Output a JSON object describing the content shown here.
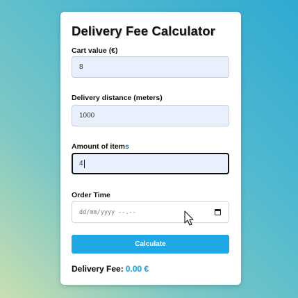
{
  "form": {
    "title": "Delivery Fee Calculator",
    "cart_value_label": "Cart value (€)",
    "cart_value": "8",
    "distance_label": "Delivery distance (meters)",
    "distance_value": "1000",
    "items_label_main": "Amount of item",
    "items_label_accent": "s",
    "items_value": "4",
    "order_time_label": "Order Time",
    "order_time_placeholder": "dd/mm/yyyy --.--",
    "calculate_label": "Calculate",
    "fee_label": "Delivery Fee:",
    "fee_value": "0.00 €"
  },
  "icons": {
    "calendar": "calendar-icon",
    "cursor": "mouse-pointer-icon"
  },
  "colors": {
    "accent": "#1ea8e6",
    "field_bg": "#e8f0fe"
  }
}
